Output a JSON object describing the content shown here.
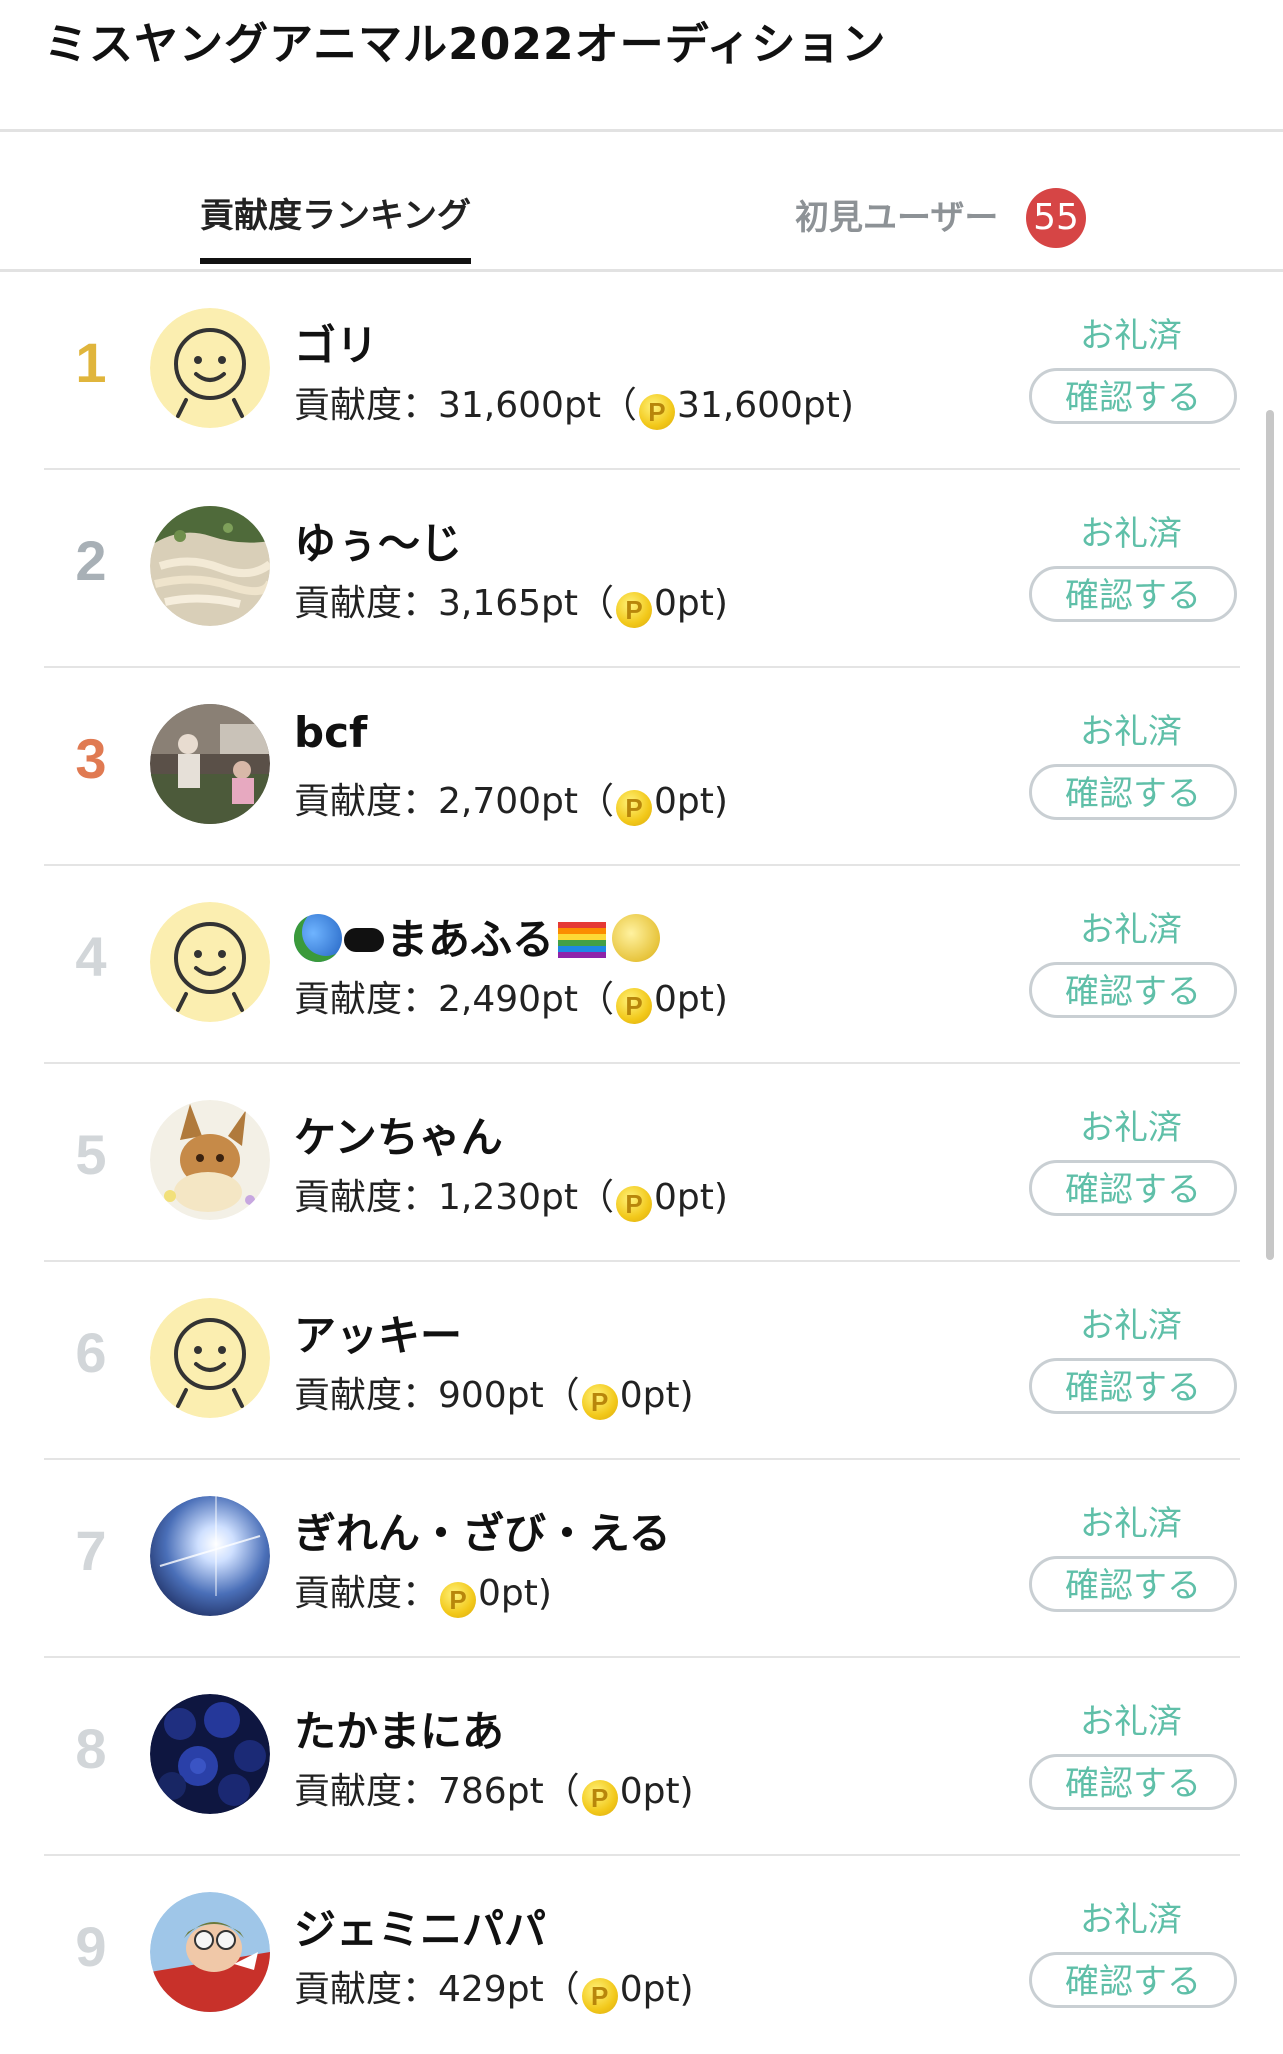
{
  "header": {
    "title": "ミスヤングアニマル2022オーディション"
  },
  "tabs": {
    "ranking_label": "貢献度ランキング",
    "new_users_label": "初見ユーザー",
    "new_users_count": "55"
  },
  "colors": {
    "rank1": "#e0b53c",
    "rank2": "#a8b0b6",
    "rank3": "#e07a52",
    "rank_other": "#d2d6d9",
    "accent_teal": "#5fbfa8",
    "badge_red": "#d64545"
  },
  "rows": [
    {
      "rank": "1",
      "name": "ゴリ",
      "contrib": "貢献度：31,600pt（",
      "coin_pt": "31,600pt)",
      "thanks": "お礼済",
      "button": "確認する",
      "avatar": "smiley-avatar"
    },
    {
      "rank": "2",
      "name": "ゆぅ〜じ",
      "contrib": "貢献度：3,165pt（",
      "coin_pt": "0pt)",
      "thanks": "お礼済",
      "button": "確認する",
      "avatar": "noodles-photo-avatar"
    },
    {
      "rank": "3",
      "name": "bcf",
      "contrib": "貢献度：2,700pt（",
      "coin_pt": "0pt)",
      "thanks": "お礼済",
      "button": "確認する",
      "avatar": "people-photo-avatar"
    },
    {
      "rank": "4",
      "name_suffix": "まあふる",
      "contrib": "貢献度：2,490pt（",
      "coin_pt": "0pt)",
      "thanks": "お礼済",
      "button": "確認する",
      "avatar": "smiley-avatar"
    },
    {
      "rank": "5",
      "name": "ケンちゃん",
      "contrib": "貢献度：1,230pt（",
      "coin_pt": "0pt)",
      "thanks": "お礼済",
      "button": "確認する",
      "avatar": "eevee-avatar"
    },
    {
      "rank": "6",
      "name": "アッキー",
      "contrib": "貢献度：900pt（",
      "coin_pt": "0pt)",
      "thanks": "お礼済",
      "button": "確認する",
      "avatar": "smiley-avatar"
    },
    {
      "rank": "7",
      "name": "ぎれん・ざび・える",
      "contrib": "貢献度：",
      "coin_pt": "0pt)",
      "thanks": "お礼済",
      "button": "確認する",
      "avatar": "sky-sun-avatar"
    },
    {
      "rank": "8",
      "name": "たかまにあ",
      "contrib": "貢献度：786pt（",
      "coin_pt": "0pt)",
      "thanks": "お礼済",
      "button": "確認する",
      "avatar": "blue-roses-avatar"
    },
    {
      "rank": "9",
      "name": "ジェミニパパ",
      "contrib": "貢献度：429pt（",
      "coin_pt": "0pt)",
      "thanks": "お礼済",
      "button": "確認する",
      "avatar": "pilot-anime-avatar"
    }
  ],
  "coin_glyph": "P"
}
